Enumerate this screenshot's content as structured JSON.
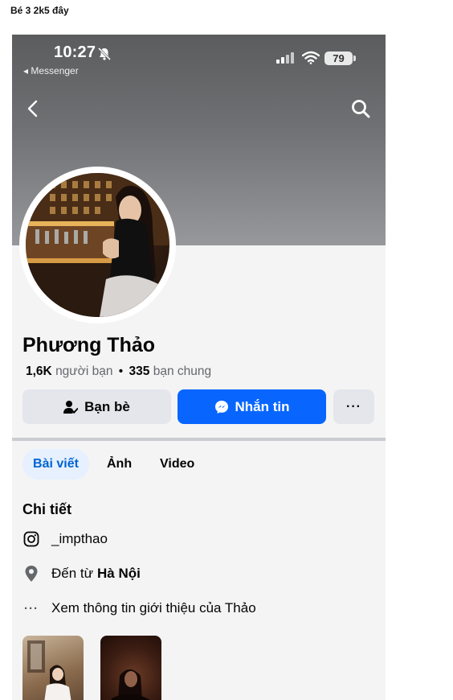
{
  "caption": "Bé 3 2k5 đây",
  "status_bar": {
    "time": "10:27",
    "back_app": "◂ Messenger",
    "battery": "79"
  },
  "profile": {
    "name": "Phương Thảo",
    "friends_count": "1,6K",
    "friends_label": "người bạn",
    "separator": "•",
    "mutual_count": "335",
    "mutual_label": "bạn chung"
  },
  "actions": {
    "friends_label": "Bạn bè",
    "message_label": "Nhắn tin",
    "more_label": "···"
  },
  "tabs": [
    {
      "label": "Bài viết",
      "active": true
    },
    {
      "label": "Ảnh",
      "active": false
    },
    {
      "label": "Video",
      "active": false
    }
  ],
  "details": {
    "title": "Chi tiết",
    "instagram": "_impthao",
    "from_prefix": "Đến từ",
    "from_place": "Hà Nội",
    "more_dots": "···",
    "more_label": "Xem thông tin giới thiệu của Thảo"
  },
  "colors": {
    "accent": "#0866ff",
    "secondary_button": "#e4e6eb",
    "active_tab_bg": "#e6f0ff",
    "active_tab_text": "#0064d1",
    "muted_text": "#65676b"
  },
  "icons": [
    "bell-slash-icon",
    "signal-icon",
    "wifi-icon",
    "back-icon",
    "search-icon",
    "friend-check-icon",
    "messenger-icon",
    "instagram-icon",
    "location-pin-icon",
    "more-dots-icon"
  ]
}
